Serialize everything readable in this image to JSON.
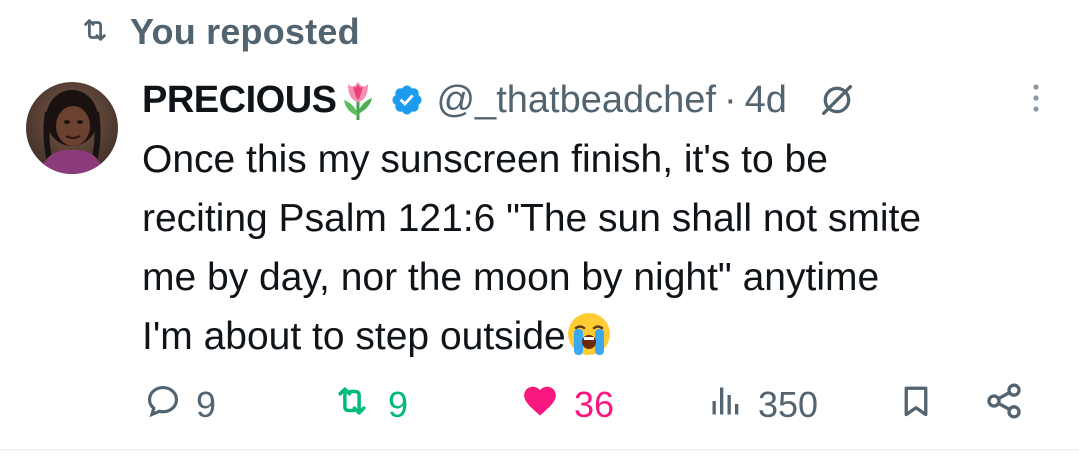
{
  "repost": {
    "label": "You reposted",
    "icon": "repost-icon"
  },
  "author": {
    "name": "PRECIOUS",
    "name_emoji": "tulip-emoji",
    "verified": true,
    "handle": "@_thatbeadchef",
    "separator": "·",
    "time": "4d"
  },
  "tweet": {
    "lines": [
      "Once this my sunscreen finish, it's to be",
      "reciting Psalm 121:6 \"The sun shall not smite",
      "me by day, nor the moon by night\" anytime",
      "I'm about to step outside"
    ],
    "trailing_emoji": "loudly-crying-face-emoji"
  },
  "actions": {
    "replies": "9",
    "reposts": "9",
    "likes": "36",
    "views": "350"
  },
  "colors": {
    "text": "#0f1419",
    "secondary": "#536471",
    "repost_active": "#00ba7c",
    "like_active": "#f91880",
    "verified": "#1d9bf0"
  }
}
